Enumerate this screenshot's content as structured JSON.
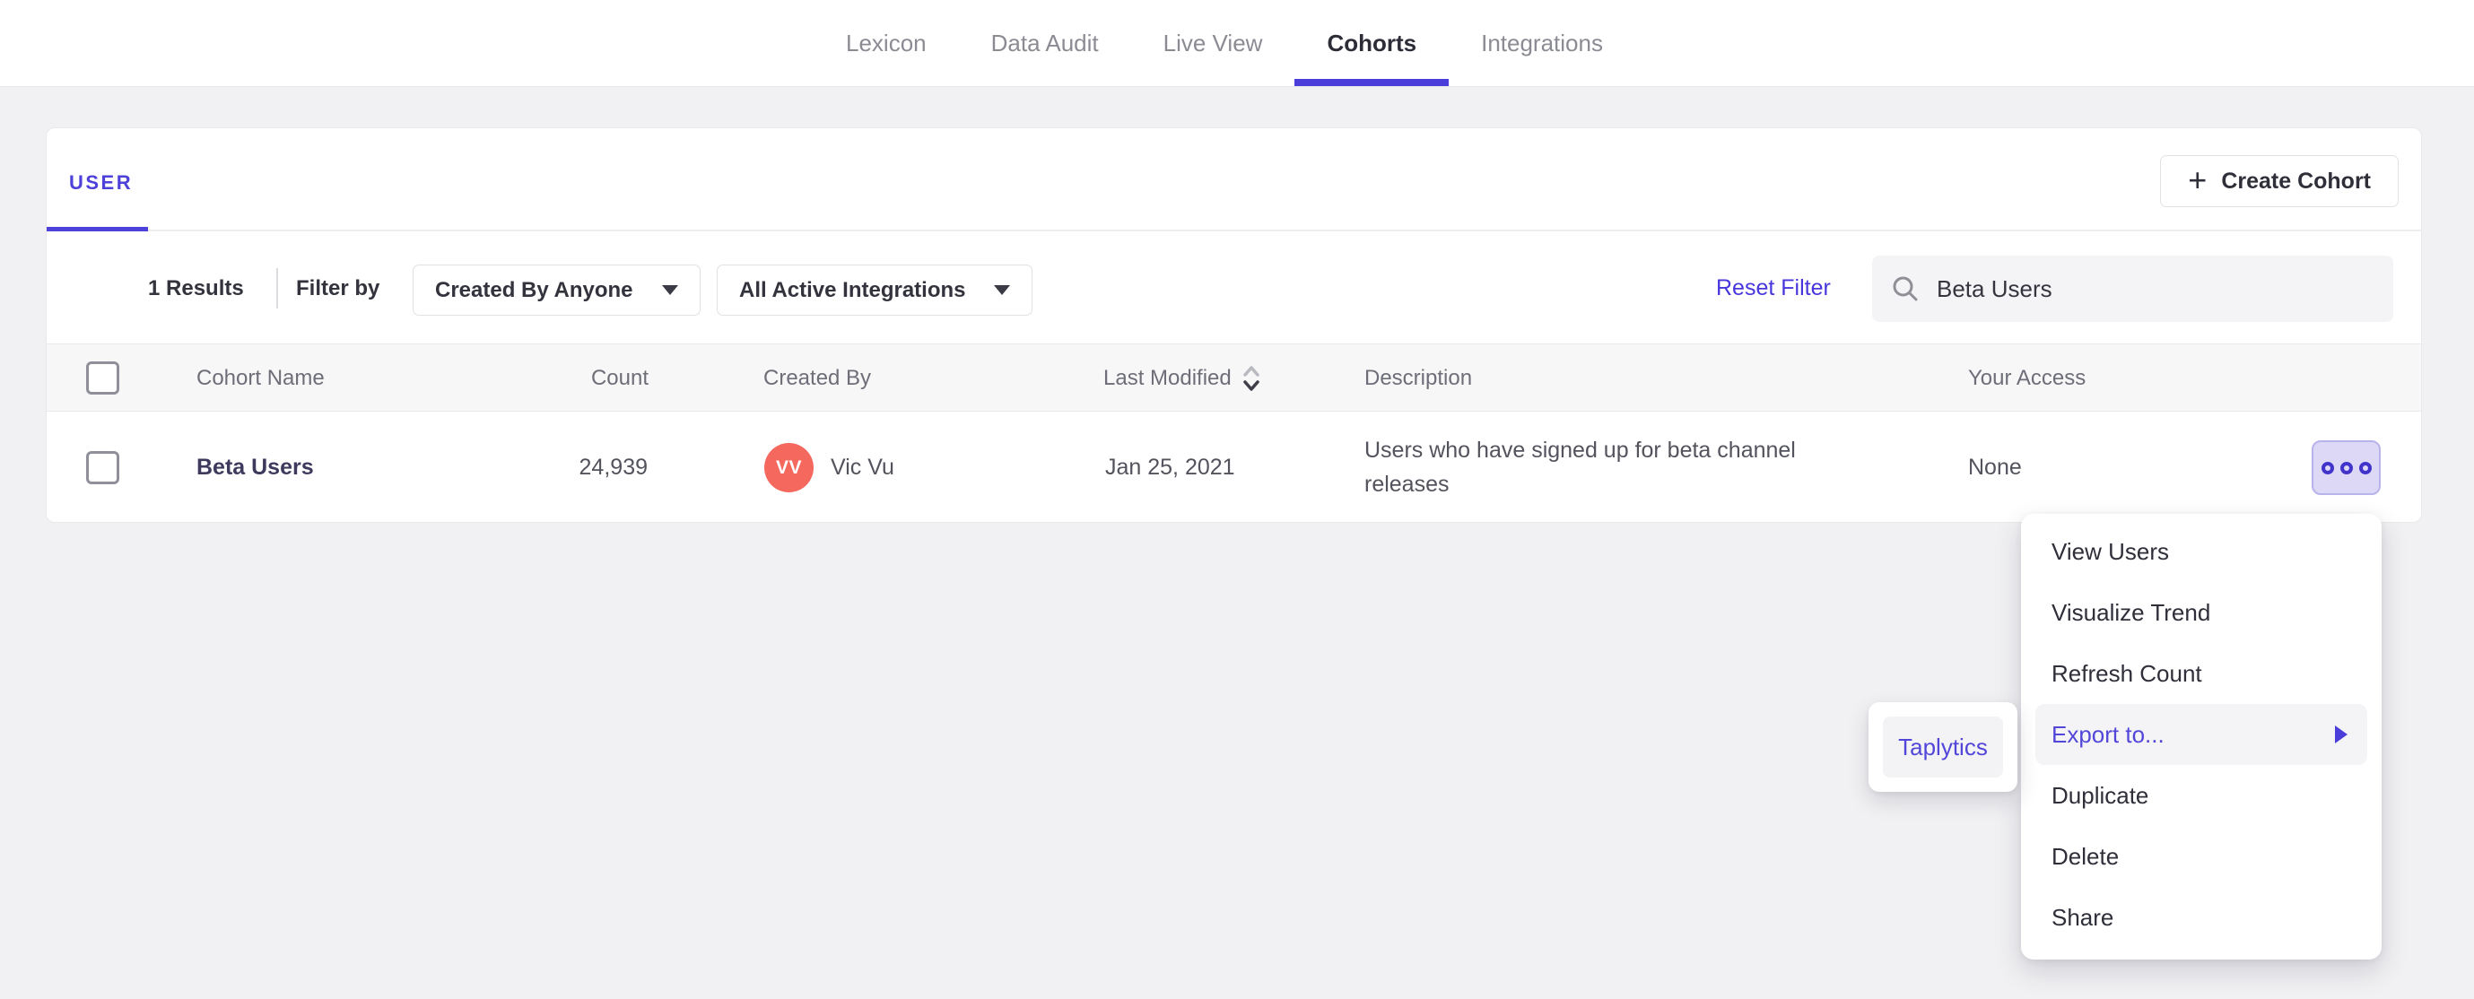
{
  "colors": {
    "accent": "#4b3dd9",
    "avatar": "#f5685e",
    "more_button_bg": "#dcd8f5",
    "link_dark": "#3e3a5e"
  },
  "navbar": {
    "tabs": [
      {
        "label": "Lexicon",
        "active": false
      },
      {
        "label": "Data Audit",
        "active": false
      },
      {
        "label": "Live View",
        "active": false
      },
      {
        "label": "Cohorts",
        "active": true
      },
      {
        "label": "Integrations",
        "active": false
      }
    ]
  },
  "card": {
    "user_tab_label": "USER",
    "create_button": {
      "plus": "+",
      "label": "Create Cohort"
    },
    "filters": {
      "results_count": "1 Results",
      "filter_by_label": "Filter by",
      "dropdowns": [
        {
          "label": "Created By Anyone"
        },
        {
          "label": "All Active Integrations"
        }
      ],
      "reset_label": "Reset Filter",
      "search": {
        "value": "Beta Users"
      }
    },
    "table": {
      "headers": [
        "Cohort Name",
        "Count",
        "Created By",
        "Last Modified",
        "Description",
        "Your Access"
      ],
      "rows": [
        {
          "name": "Beta Users",
          "count": "24,939",
          "created_by": {
            "initials": "VV",
            "name": "Vic Vu"
          },
          "last_modified": "Jan 25, 2021",
          "description": "Users who have signed up for beta channel releases",
          "access": "None"
        }
      ]
    }
  },
  "context_menu": {
    "items": [
      "View Users",
      "Visualize Trend",
      "Refresh Count",
      "Export to...",
      "Duplicate",
      "Delete",
      "Share"
    ],
    "highlighted_item": "Export to...",
    "submenu": {
      "items": [
        "Taplytics"
      ]
    }
  }
}
